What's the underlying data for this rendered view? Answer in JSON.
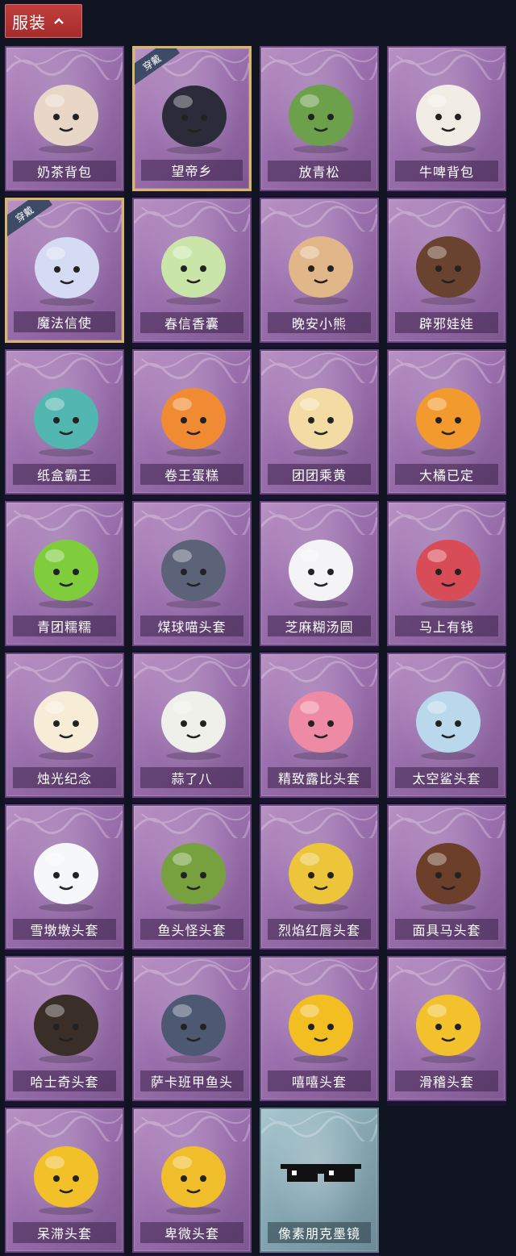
{
  "header": {
    "title": "服装"
  },
  "items": [
    {
      "label": "奶茶背包",
      "tag": "",
      "color": "#e8d7c7"
    },
    {
      "label": "望帝乡",
      "tag": "穿戴",
      "color": "#2b2b3a"
    },
    {
      "label": "放青松",
      "tag": "",
      "color": "#6ca04a"
    },
    {
      "label": "牛啤背包",
      "tag": "",
      "color": "#f1ede5"
    },
    {
      "label": "魔法信使",
      "tag": "穿戴",
      "color": "#d5dbf2"
    },
    {
      "label": "春信香囊",
      "tag": "",
      "color": "#c9e6a8"
    },
    {
      "label": "晚安小熊",
      "tag": "",
      "color": "#e1b789"
    },
    {
      "label": "辟邪娃娃",
      "tag": "",
      "color": "#6a4230"
    },
    {
      "label": "纸盒霸王",
      "tag": "",
      "color": "#51b7b0"
    },
    {
      "label": "卷王蛋糕",
      "tag": "",
      "color": "#f08a33"
    },
    {
      "label": "团团乘黄",
      "tag": "",
      "color": "#f3dca3"
    },
    {
      "label": "大橘已定",
      "tag": "",
      "color": "#f39a2e"
    },
    {
      "label": "青团糯糯",
      "tag": "",
      "color": "#7fcc3d"
    },
    {
      "label": "煤球喵头套",
      "tag": "",
      "color": "#5c6378"
    },
    {
      "label": "芝麻糊汤圆",
      "tag": "",
      "color": "#f4f4f6"
    },
    {
      "label": "马上有钱",
      "tag": "",
      "color": "#d84c57"
    },
    {
      "label": "烛光纪念",
      "tag": "",
      "color": "#f7ecd6"
    },
    {
      "label": "蒜了八",
      "tag": "",
      "color": "#eef0e9"
    },
    {
      "label": "精致露比头套",
      "tag": "",
      "color": "#ef8aa4"
    },
    {
      "label": "太空鲨头套",
      "tag": "",
      "color": "#b9d8ec"
    },
    {
      "label": "雪墩墩头套",
      "tag": "",
      "color": "#f6f7fb"
    },
    {
      "label": "鱼头怪头套",
      "tag": "",
      "color": "#77a13f"
    },
    {
      "label": "烈焰红唇头套",
      "tag": "",
      "color": "#ecc53a"
    },
    {
      "label": "面具马头套",
      "tag": "",
      "color": "#6b3f2a"
    },
    {
      "label": "哈士奇头套",
      "tag": "",
      "color": "#3a2e28"
    },
    {
      "label": "萨卡班甲鱼头",
      "tag": "",
      "color": "#4d5872"
    },
    {
      "label": "嘻嘻头套",
      "tag": "",
      "color": "#f3be22"
    },
    {
      "label": "滑稽头套",
      "tag": "",
      "color": "#f3c12c"
    },
    {
      "label": "呆滞头套",
      "tag": "",
      "color": "#f2c12a"
    },
    {
      "label": "卑微头套",
      "tag": "",
      "color": "#f0be2b"
    },
    {
      "label": "像素朋克墨镜",
      "tag": "",
      "color": "#111111",
      "blue": true
    }
  ]
}
